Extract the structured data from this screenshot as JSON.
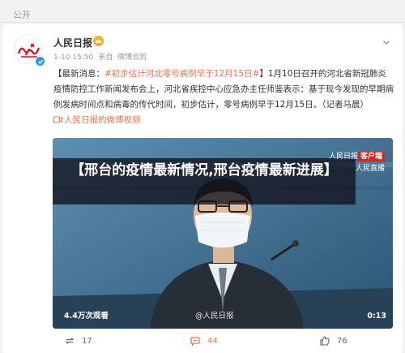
{
  "section_label": "公开",
  "post": {
    "author": "人民日报",
    "time": "1-10 15:50",
    "source_prefix": "来自",
    "source": "微博云剪",
    "text": {
      "prefix": "【最新消息：",
      "topic": "#初步估计河北零号病例早于12月15日#",
      "body": "】1月10日召开的河北省新冠肺炎疫情防控工作新闻发布会上，河北省疾控中心应急办主任师鉴表示：基于现今发现的早期病例发病时间点和病毒的传代时间，初步估计，零号病例早于12月15日。（记者马晨）",
      "video_link": "人民日报的微博视频"
    },
    "video": {
      "banner": "【邢台的疫情最新情况,邢台疫情最新进展】",
      "brand": "人民日报",
      "brand_tag": "客户端",
      "brand_sub": "人民直播",
      "views": "4.4万次观看",
      "watermark": "@人民日报",
      "duration": "0:13"
    },
    "actions": {
      "reposts": "17",
      "comments": "44",
      "likes": "76"
    }
  },
  "colors": {
    "accent": "#eb7350",
    "verified": "#2f95e8",
    "brand_red": "#d6281e"
  },
  "icons": [
    "verified-icon",
    "crown-badge-icon",
    "chevron-down-icon",
    "video-link-icon",
    "repost-icon",
    "comment-icon",
    "like-icon"
  ]
}
